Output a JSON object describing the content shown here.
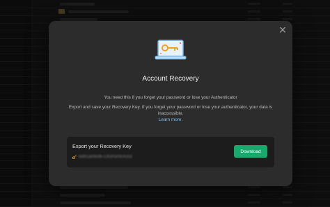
{
  "modal": {
    "title": "Account Recovery",
    "description": "You need this if you forget your password or lose your Authenticator",
    "details": "Export and save your Recovery Key. If you forget your password or lose your authenticator, your data is inaccessible.",
    "learn_more": "Learn more.",
    "close_icon": "close-icon",
    "illustration_icon": "laptop-key-icon"
  },
  "recovery_key": {
    "label": "Export your Recovery Key",
    "value_masked": "tu9t1a0fe96-CKtPurNrXzsz",
    "download_label": "Download"
  },
  "colors": {
    "accent": "#1aa96d",
    "link": "#7fbef5",
    "modal_bg": "#2c2c2c",
    "key_box_bg": "#1c1c1c"
  }
}
